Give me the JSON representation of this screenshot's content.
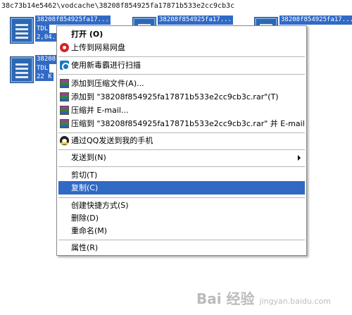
{
  "path": "38c73b14e5462\\vodcache\\38208f854925fa17871b533e2cc9cb3c",
  "files": [
    {
      "name": "38208f854925fa17...",
      "type": "TDL",
      "size": "2,04..."
    },
    {
      "name": "38208f854925fa17...",
      "type": "",
      "size": ""
    },
    {
      "name": "38208f854925fa17...",
      "type": "",
      "size": ""
    },
    {
      "name": "38208f854925fa17...",
      "type": "TDL",
      "size": "22 K"
    }
  ],
  "menu": {
    "items": [
      {
        "label": "打开 (O)",
        "icon": "none",
        "bold": true
      },
      {
        "label": "上传到网易网盘",
        "icon": "netease-icon"
      },
      {
        "label": "使用新毒霸进行扫描",
        "icon": "shield-icon"
      },
      {
        "label": "添加到压缩文件(A)...",
        "icon": "rar-icon"
      },
      {
        "label": "添加到 \"38208f854925fa17871b533e2cc9cb3c.rar\"(T)",
        "icon": "rar-icon"
      },
      {
        "label": "压缩并 E-mail...",
        "icon": "rar-icon"
      },
      {
        "label": "压缩到 \"38208f854925fa17871b533e2cc9cb3c.rar\" 并 E-mail",
        "icon": "rar-icon"
      },
      {
        "label": "通过QQ发送到我的手机",
        "icon": "qq-icon"
      },
      {
        "label": "发送到(N)",
        "icon": "none",
        "submenu": true
      },
      {
        "label": "剪切(T)",
        "icon": "none"
      },
      {
        "label": "复制(C)",
        "icon": "none",
        "highlighted": true
      },
      {
        "label": "创建快捷方式(S)",
        "icon": "none"
      },
      {
        "label": "删除(D)",
        "icon": "none"
      },
      {
        "label": "重命名(M)",
        "icon": "none"
      },
      {
        "label": "属性(R)",
        "icon": "none"
      }
    ]
  },
  "watermark": {
    "brand": "Bai 经验",
    "sub": "jingyan.baidu.com"
  },
  "colors": {
    "highlight": "#316ac5",
    "file_icon": "#2e67b1"
  }
}
